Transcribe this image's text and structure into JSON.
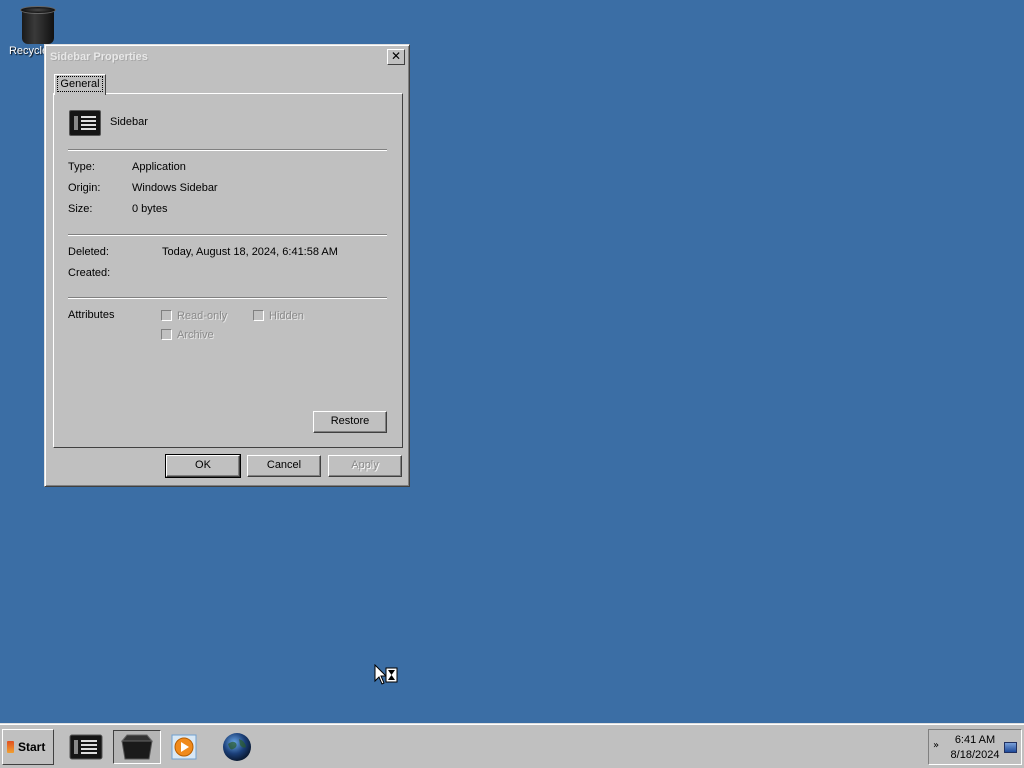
{
  "desktop": {
    "recycle_bin_label": "Recycle Bin"
  },
  "dialog": {
    "title": "Sidebar Properties",
    "close_glyph": "✕",
    "tab_general": "General",
    "app_name": "Sidebar",
    "type_label": "Type:",
    "type_value": "Application",
    "origin_label": "Origin:",
    "origin_value": "Windows Sidebar",
    "size_label": "Size:",
    "size_value": "0 bytes",
    "deleted_label": "Deleted:",
    "deleted_value": "Today, August 18, 2024, 6:41:58 AM",
    "created_label": "Created:",
    "attributes_label": "Attributes",
    "readonly_label": "Read-only",
    "hidden_label": "Hidden",
    "archive_label": "Archive",
    "restore_button": "Restore",
    "ok_button": "OK",
    "cancel_button": "Cancel",
    "apply_button": "Apply"
  },
  "taskbar": {
    "start_label": "Start",
    "clock_time": "6:41 AM",
    "clock_date": "8/18/2024",
    "tray_chevron": "»"
  }
}
